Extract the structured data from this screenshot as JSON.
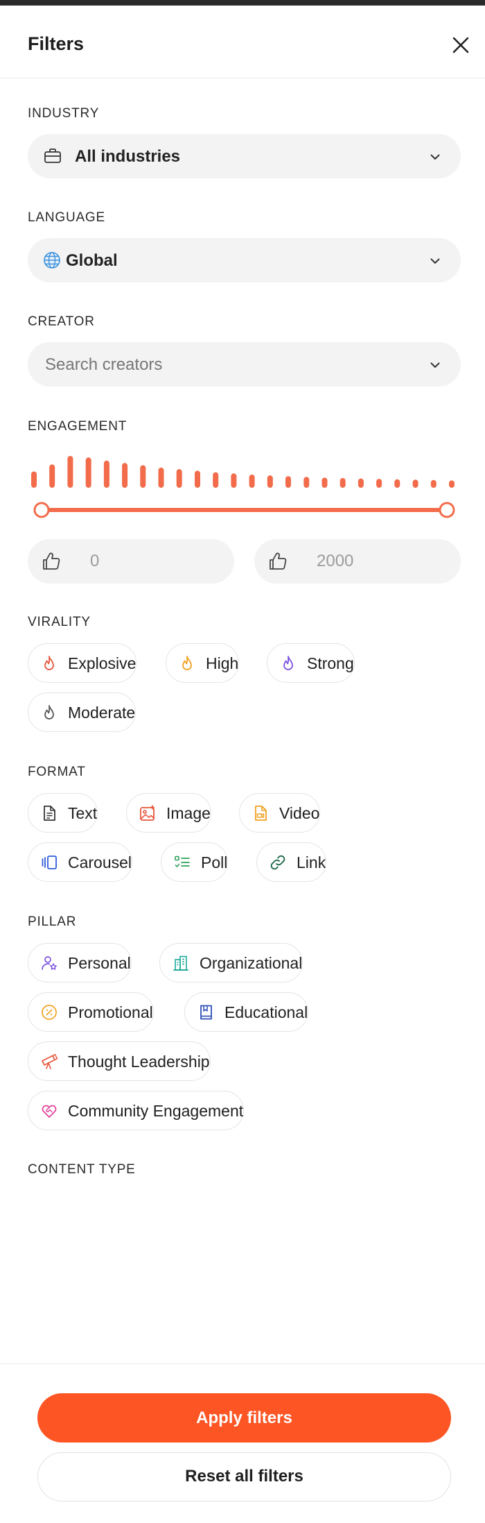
{
  "header": {
    "title": "Filters",
    "close_icon": "close-icon"
  },
  "industry": {
    "label": "INDUSTRY",
    "value": "All industries",
    "icon": "briefcase-icon"
  },
  "language": {
    "label": "LANGUAGE",
    "value": "Global",
    "icon": "globe-icon"
  },
  "creator": {
    "label": "CREATOR",
    "placeholder": "Search creators"
  },
  "engagement": {
    "label": "ENGAGEMENT",
    "min_value": "0",
    "max_value": "2000",
    "range_selected": [
      0,
      1
    ],
    "accent": "#f26b4a",
    "histogram": [
      0.42,
      0.6,
      0.82,
      0.78,
      0.7,
      0.64,
      0.58,
      0.52,
      0.48,
      0.44,
      0.4,
      0.37,
      0.34,
      0.32,
      0.3,
      0.28,
      0.26,
      0.25,
      0.24,
      0.23,
      0.22,
      0.21,
      0.2,
      0.19
    ]
  },
  "virality": {
    "label": "VIRALITY",
    "chips": [
      {
        "label": "Explosive",
        "icon": "flame-icon",
        "color": "#e8553a"
      },
      {
        "label": "High",
        "icon": "flame-icon",
        "color": "#f0a020"
      },
      {
        "label": "Strong",
        "icon": "flame-icon",
        "color": "#7a52e0"
      },
      {
        "label": "Moderate",
        "icon": "flame-icon",
        "color": "#555555"
      }
    ]
  },
  "format": {
    "label": "FORMAT",
    "chips": [
      {
        "label": "Text",
        "icon": "document-icon",
        "color": "#333333"
      },
      {
        "label": "Image",
        "icon": "image-icon",
        "color": "#e8553a"
      },
      {
        "label": "Video",
        "icon": "video-file-icon",
        "color": "#f0a020"
      },
      {
        "label": "Carousel",
        "icon": "carousel-icon",
        "color": "#2f5bd8"
      },
      {
        "label": "Poll",
        "icon": "poll-icon",
        "color": "#2fa05a"
      },
      {
        "label": "Link",
        "icon": "link-icon",
        "color": "#1e6a4a"
      }
    ]
  },
  "pillar": {
    "label": "PILLAR",
    "chips": [
      {
        "label": "Personal",
        "icon": "person-star-icon",
        "color": "#7a52e0"
      },
      {
        "label": "Organizational",
        "icon": "building-icon",
        "color": "#1aa89a"
      },
      {
        "label": "Promotional",
        "icon": "discount-icon",
        "color": "#f0a020"
      },
      {
        "label": "Educational",
        "icon": "book-icon",
        "color": "#2f4fb8"
      },
      {
        "label": "Thought Leadership",
        "icon": "telescope-icon",
        "color": "#e8553a"
      },
      {
        "label": "Community Engagement",
        "icon": "heart-handshake-icon",
        "color": "#e0449a"
      }
    ]
  },
  "content_type": {
    "label": "CONTENT TYPE"
  },
  "footer": {
    "apply_label": "Apply filters",
    "reset_label": "Reset all filters",
    "apply_color": "#fd5524"
  }
}
